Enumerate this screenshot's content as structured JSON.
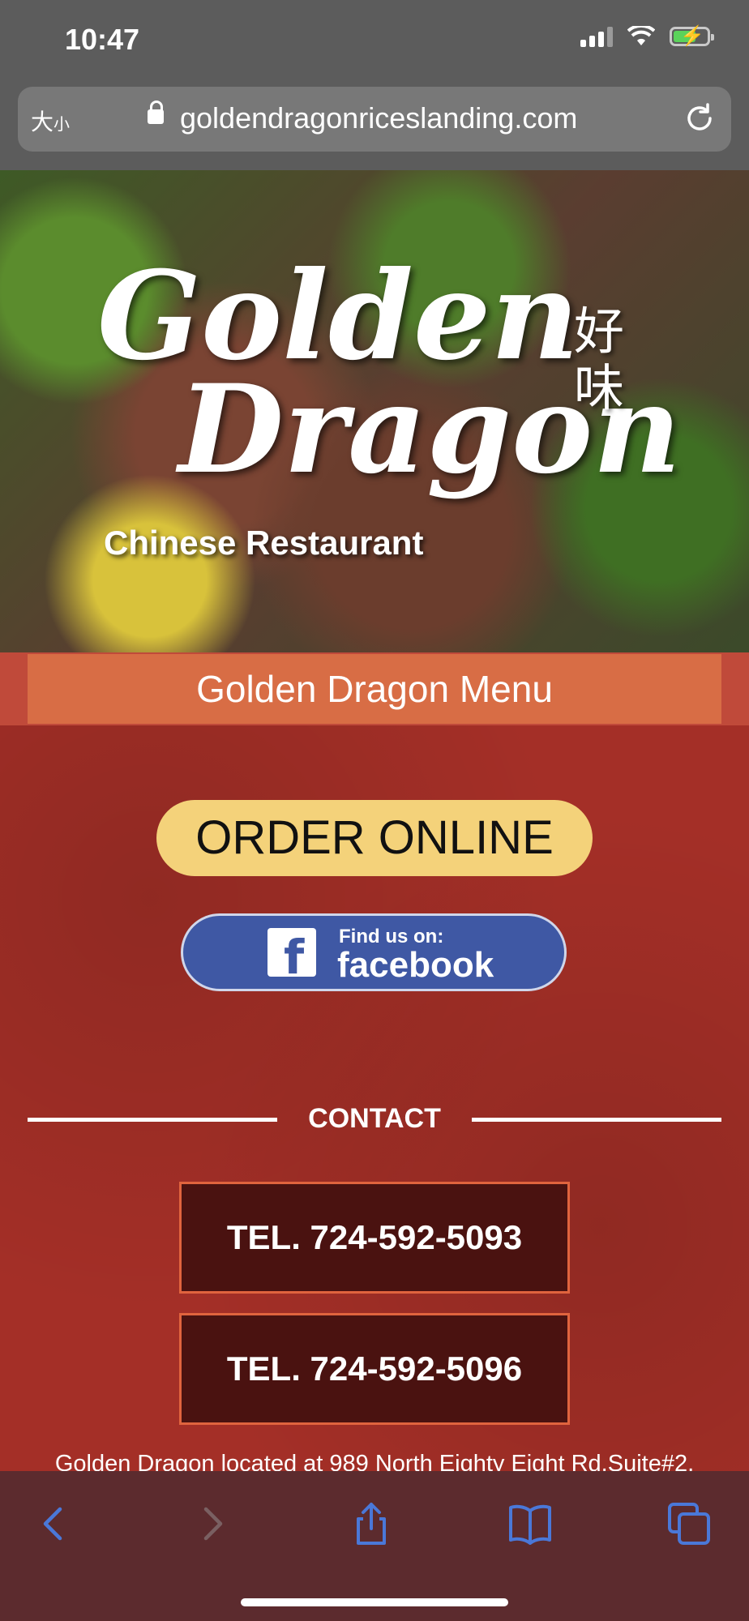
{
  "status_bar": {
    "time": "10:47"
  },
  "browser": {
    "text_size_label": "大",
    "text_size_small": "小",
    "url": "goldendragonriceslanding.com"
  },
  "hero": {
    "logo_line1": "Golden",
    "logo_line2": "Dragon",
    "logo_chinese": "好味",
    "logo_subtitle": "Chinese Restaurant"
  },
  "menu_button": "Golden Dragon Menu",
  "order_button": "ORDER ONLINE",
  "facebook": {
    "find_text": "Find us on:",
    "brand": "facebook",
    "logo_letter": "f"
  },
  "contact": {
    "title": "CONTACT",
    "phones": [
      "TEL. 724-592-5093",
      "TEL. 724-592-5096"
    ],
    "address_text": "Golden Dragon located at 989 North Eighty Eight Rd.Suite#2,"
  },
  "colors": {
    "page_red": "#a42f27",
    "menu_orange": "#d86d45",
    "order_yellow": "#f4d27a",
    "facebook_blue": "#3f58a4",
    "tel_border": "#e0643e",
    "link_blue": "#4a78d8"
  },
  "toolbar_icons": [
    "back-icon",
    "forward-icon",
    "share-icon",
    "bookmarks-icon",
    "tabs-icon"
  ]
}
